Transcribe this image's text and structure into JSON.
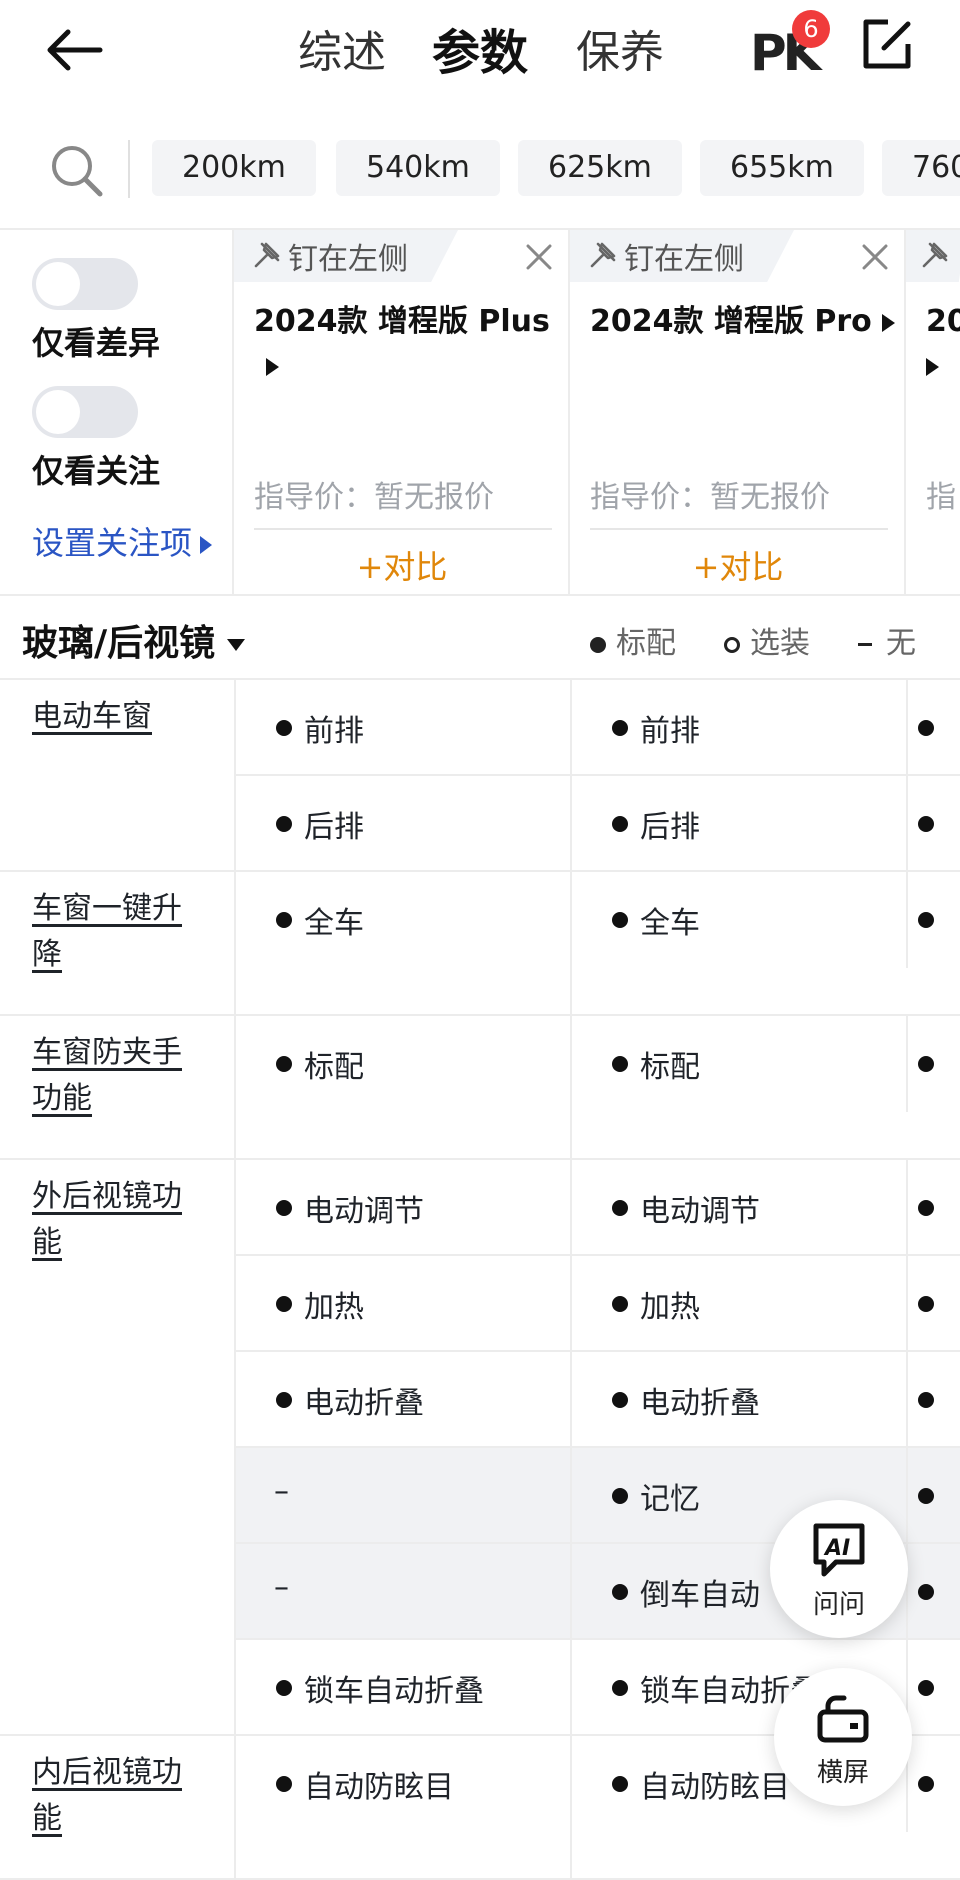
{
  "nav": {
    "tabs": [
      "综述",
      "参数",
      "保养"
    ],
    "active_tab": "参数",
    "pk_label": "PK",
    "pk_badge": "6"
  },
  "ranges": [
    "200km",
    "540km",
    "625km",
    "655km",
    "760"
  ],
  "filters": {
    "diff_label": "仅看差异",
    "focus_label": "仅看关注",
    "set_focus_label": "设置关注项"
  },
  "cars": [
    {
      "pin_label": "钉在左侧",
      "name": "2024款 增程版 Plus",
      "price": "指导价：暂无报价",
      "compare": "+对比"
    },
    {
      "pin_label": "钉在左侧",
      "name": "2024款 增程版 Pro",
      "price": "指导价：暂无报价",
      "compare": "+对比"
    },
    {
      "pin_label": "",
      "name": "20",
      "price": "指",
      "compare": ""
    }
  ],
  "section": {
    "title": "玻璃/后视镜",
    "legend": {
      "standard": "标配",
      "optional": "选装",
      "none": "无"
    }
  },
  "params": [
    {
      "label": "电动车窗",
      "rows": [
        {
          "c1": "前排",
          "c2": "前排"
        },
        {
          "c1": "后排",
          "c2": "后排"
        }
      ]
    },
    {
      "label": "车窗一键升降",
      "rows": [
        {
          "c1": "全车",
          "c2": "全车"
        }
      ]
    },
    {
      "label": "车窗防夹手功能",
      "rows": [
        {
          "c1": "标配",
          "c2": "标配"
        }
      ]
    },
    {
      "label": "外后视镜功能",
      "rows": [
        {
          "c1": "电动调节",
          "c2": "电动调节"
        },
        {
          "c1": "加热",
          "c2": "加热"
        },
        {
          "c1": "电动折叠",
          "c2": "电动折叠"
        },
        {
          "c1": "–",
          "c2": "记忆",
          "diff": true
        },
        {
          "c1": "–",
          "c2": "倒车自动",
          "diff": true
        },
        {
          "c1": "锁车自动折叠",
          "c2": "锁车自动折叠"
        }
      ]
    },
    {
      "label": "内后视镜功能",
      "rows": [
        {
          "c1": "自动防眩目",
          "c2": "自动防眩目"
        }
      ]
    }
  ],
  "fabs": {
    "ask_label": "问问",
    "ask_icon_text": "AI",
    "landscape_label": "横屏"
  },
  "icons": {
    "back": "arrow-left",
    "edit": "edit-square",
    "search": "magnifier",
    "pin": "pin",
    "close": "x"
  }
}
